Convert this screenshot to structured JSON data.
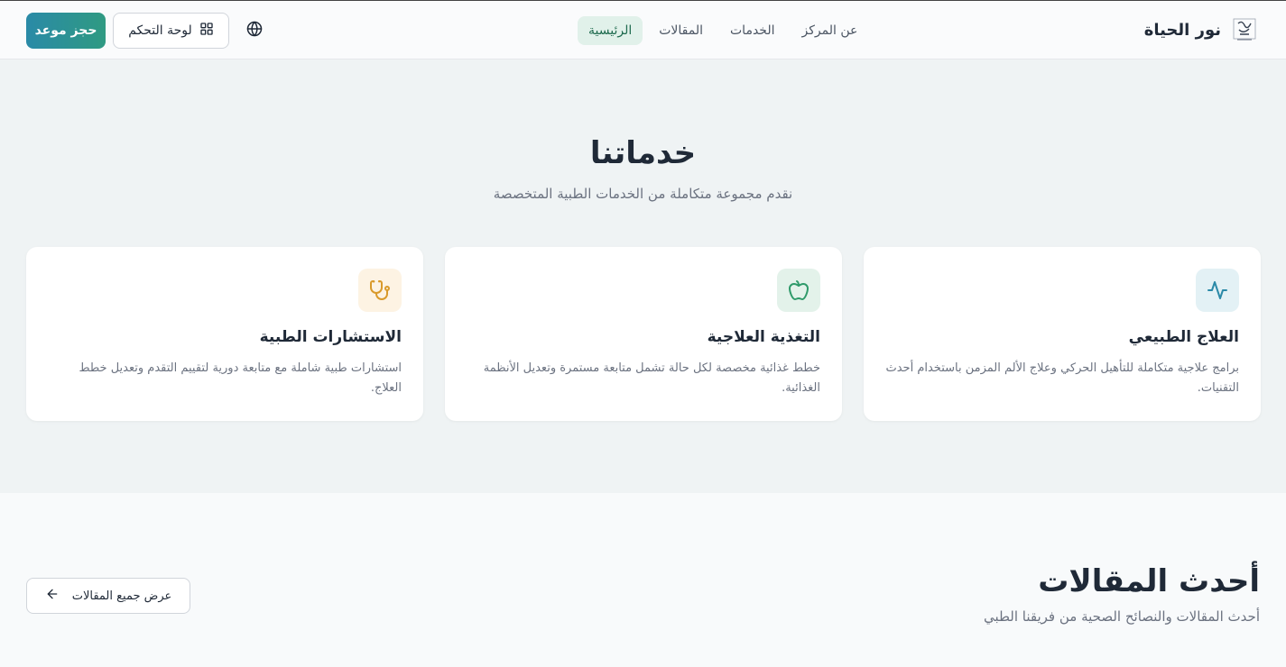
{
  "header": {
    "brand_name": "نور الحياة",
    "logo_icon": "logo-calligraphy-icon",
    "nav": [
      {
        "label": "الرئيسية",
        "active": true
      },
      {
        "label": "المقالات",
        "active": false
      },
      {
        "label": "الخدمات",
        "active": false
      },
      {
        "label": "عن المركز",
        "active": false
      }
    ],
    "globe_icon": "globe-icon",
    "dashboard_label": "لوحة التحكم",
    "dashboard_icon": "grid-icon",
    "book_label": "حجز موعد"
  },
  "services": {
    "title": "خدماتنا",
    "subtitle": "نقدم مجموعة متكاملة من الخدمات الطبية المتخصصة",
    "cards": [
      {
        "title": "العلاج الطبيعي",
        "description": "برامج علاجية متكاملة للتأهيل الحركي وعلاج الألم المزمن باستخدام أحدث التقنيات.",
        "icon": "activity-pulse-icon",
        "icon_color": "#2b8aa8",
        "icon_bg": "#e3f1f5"
      },
      {
        "title": "التغذية العلاجية",
        "description": "خطط غذائية مخصصة لكل حالة تشمل متابعة مستمرة وتعديل الأنظمة الغذائية.",
        "icon": "apple-icon",
        "icon_color": "#2f9a6a",
        "icon_bg": "#e3f2ea"
      },
      {
        "title": "الاستشارات الطبية",
        "description": "استشارات طبية شاملة مع متابعة دورية لتقييم التقدم وتعديل خطط العلاج.",
        "icon": "stethoscope-icon",
        "icon_color": "#d99a2b",
        "icon_bg": "#fdf3e3"
      }
    ]
  },
  "articles": {
    "title": "أحدث المقالات",
    "subtitle": "أحدث المقالات والنصائح الصحية من فريقنا الطبي",
    "view_all_label": "عرض جميع المقالات",
    "view_all_icon": "arrow-left-icon"
  }
}
